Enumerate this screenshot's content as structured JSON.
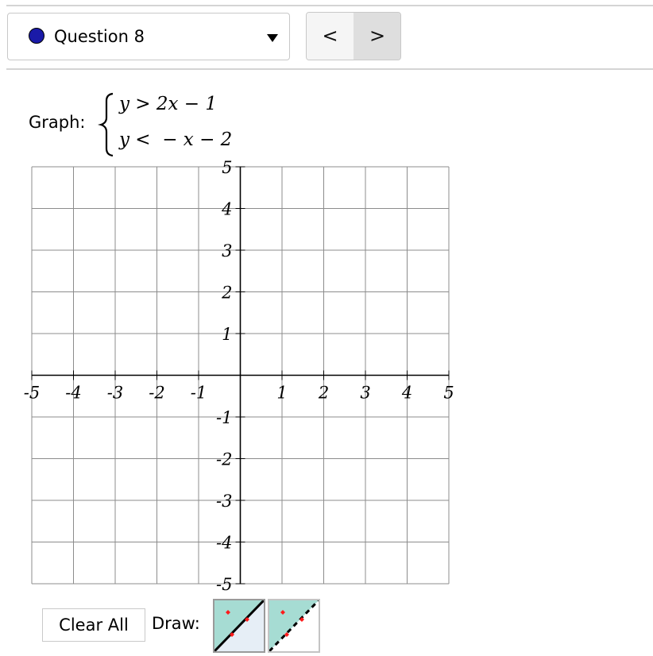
{
  "header": {
    "question_label": "Question 8",
    "status_color": "#1a1aa8",
    "prev_glyph": "<",
    "next_glyph": ">"
  },
  "problem": {
    "prompt": "Graph:",
    "inequalities": [
      "y > 2x − 1",
      "y <  − x − 2"
    ]
  },
  "graph": {
    "x_range": [
      -5,
      5
    ],
    "y_range": [
      -5,
      5
    ],
    "grid_step": 1,
    "x_tick_labels": [
      "-5",
      "-4",
      "-3",
      "-2",
      "-1",
      "1",
      "2",
      "3",
      "4",
      "5"
    ],
    "y_tick_labels": [
      "5",
      "4",
      "3",
      "2",
      "1",
      "-1",
      "-2",
      "-3",
      "-4",
      "-5"
    ],
    "grid_color": "#8c8c8c",
    "axis_color": "#000000"
  },
  "toolbar": {
    "clear_label": "Clear All",
    "draw_label": "Draw:",
    "tools": [
      {
        "name": "solid-line-tool",
        "style": "solid",
        "selected": true
      },
      {
        "name": "dashed-line-tool",
        "style": "dashed",
        "selected": false
      }
    ],
    "tool_bg": "#a6dcd3",
    "selected_tool_bg": "#e6eef6",
    "point_color": "#ff1a1a"
  }
}
